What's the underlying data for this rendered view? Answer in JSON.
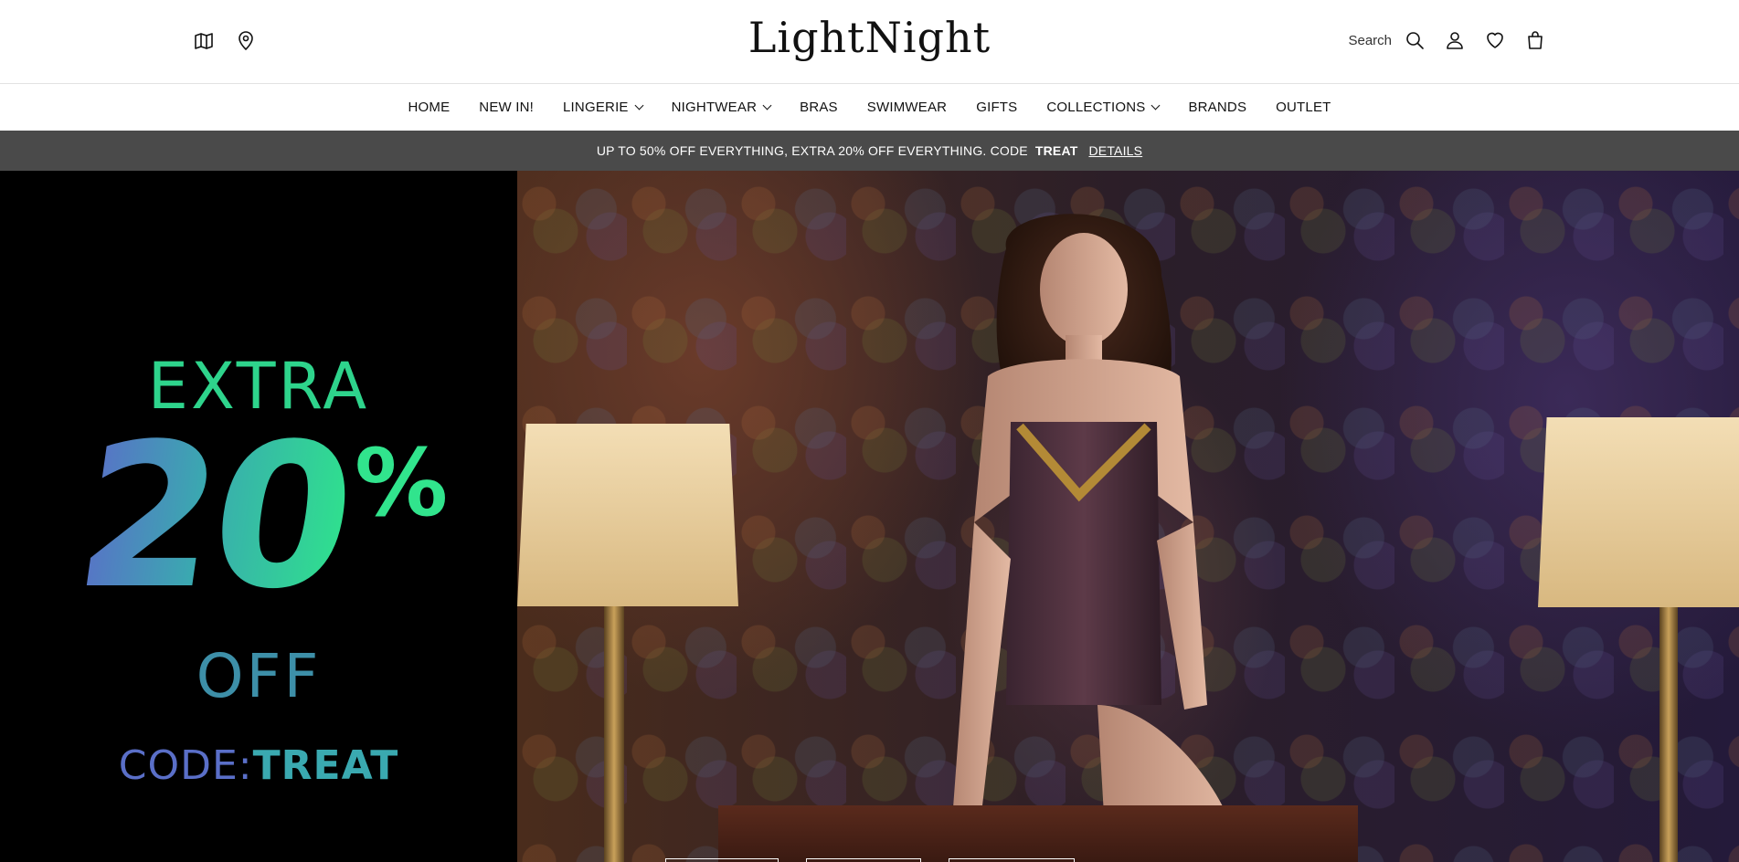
{
  "header": {
    "logo": "LightNight",
    "search_label": "Search"
  },
  "nav": {
    "items": [
      {
        "label": "HOME",
        "dropdown": false
      },
      {
        "label": "NEW IN!",
        "dropdown": false
      },
      {
        "label": "LINGERIE",
        "dropdown": true
      },
      {
        "label": "NIGHTWEAR",
        "dropdown": true
      },
      {
        "label": "BRAS",
        "dropdown": false
      },
      {
        "label": "SWIMWEAR",
        "dropdown": false
      },
      {
        "label": "GIFTS",
        "dropdown": false
      },
      {
        "label": "COLLECTIONS",
        "dropdown": true
      },
      {
        "label": "BRANDS",
        "dropdown": false
      },
      {
        "label": "OUTLET",
        "dropdown": false
      }
    ]
  },
  "promo": {
    "text": "UP TO 50% OFF EVERYTHING, EXTRA 20% OFF EVERYTHING. CODE",
    "code": "TREAT",
    "link": "DETAILS"
  },
  "hero": {
    "extra": "EXTRA",
    "amount": "20",
    "percent": "%",
    "off": "OFF",
    "code_label": "CODE:",
    "code_value": "TREAT"
  },
  "colors": {
    "promo_bg": "#4a4a4a",
    "gradient_start": "#5a6fc8",
    "gradient_end": "#2fe08e"
  },
  "icons": {
    "left": [
      "map-icon",
      "location-pin-icon"
    ],
    "right": [
      "search-icon",
      "user-icon",
      "heart-icon",
      "bag-icon"
    ]
  }
}
